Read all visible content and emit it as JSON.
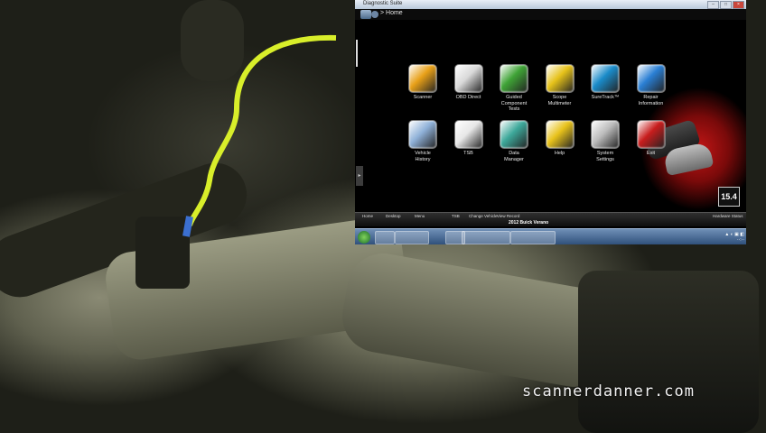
{
  "window": {
    "title": "Diagnostic Suite",
    "breadcrumb": "> Home",
    "controls": [
      "–",
      "□",
      "×"
    ]
  },
  "apps": [
    {
      "label": "Scanner",
      "icon": "scanner-icon",
      "color": "#e8a018"
    },
    {
      "label": "OBD Direct",
      "icon": "obd-direct-icon",
      "color": "#d9d9d9"
    },
    {
      "label": "Guided\nComponent\nTests",
      "icon": "guided-tests-icon",
      "color": "#3fa336"
    },
    {
      "label": "Scope\nMultimeter",
      "icon": "scope-multimeter-icon",
      "color": "#e6c21a"
    },
    {
      "label": "SureTrack™",
      "icon": "suretrack-icon",
      "color": "#1a8bc9"
    },
    {
      "label": "Repair\nInformation",
      "icon": "repair-information-icon",
      "color": "#2a7fd4"
    },
    {
      "label": "Vehicle\nHistory",
      "icon": "vehicle-history-icon",
      "color": "#8fb1d8"
    },
    {
      "label": "TSB",
      "icon": "tsb-icon",
      "color": "#e7e7e7"
    },
    {
      "label": "Data\nManager",
      "icon": "data-manager-icon",
      "color": "#3da89a"
    },
    {
      "label": "Help",
      "icon": "help-icon",
      "color": "#e8c21b"
    },
    {
      "label": "System\nSettings",
      "icon": "system-settings-icon",
      "color": "#bcbcbc"
    },
    {
      "label": "Exit",
      "icon": "exit-icon",
      "color": "#c81d1d"
    }
  ],
  "version_badge": "15.4",
  "navbar": {
    "items": [
      "Home",
      "Desktop",
      "Menu",
      "TSB",
      "Change Vehicle",
      "View Record"
    ],
    "vehicle": "2012 Buick Verano",
    "hardware_status": "Hardware Status"
  },
  "watermark": "scannerdanner.com"
}
